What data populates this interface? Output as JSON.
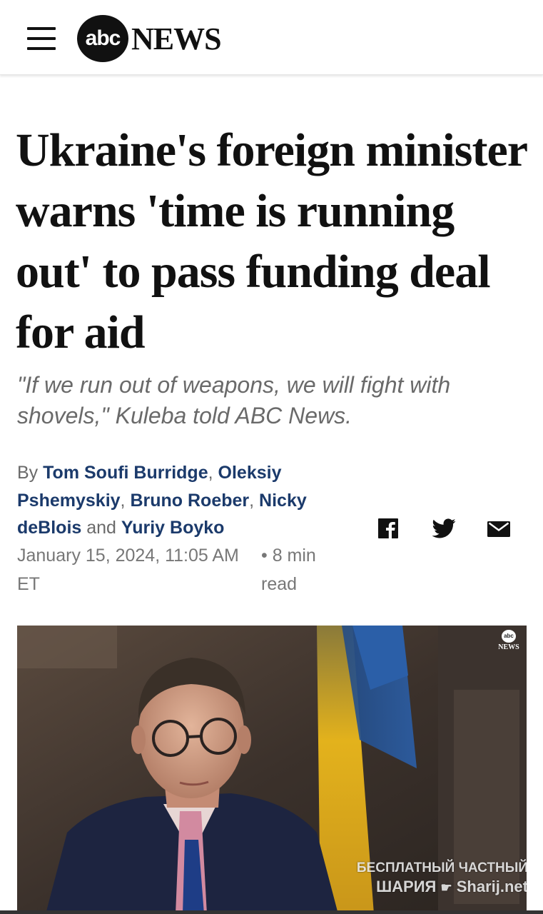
{
  "header": {
    "menu_icon": "hamburger-menu-icon",
    "logo_mark": "abc",
    "logo_word": "NEWS"
  },
  "article": {
    "headline": "Ukraine's foreign minister warns 'time is running out' to pass funding deal for aid",
    "dek": "\"If we run out of weapons, we will fight with shovels,\" Kuleba told ABC News.",
    "byline": {
      "prefix": "By",
      "authors": [
        "Tom Soufi Burridge",
        "Oleksiy Pshemyskiy",
        "Bruno Roeber",
        "Nicky deBlois",
        "Yuriy Boyko"
      ],
      "separator": ",",
      "conjunction": "and"
    },
    "date": "January 15, 2024, 11:05 AM ET",
    "read_time": "• 8 min read"
  },
  "share": {
    "facebook_icon": "facebook-icon",
    "twitter_icon": "twitter-icon",
    "email_icon": "email-icon"
  },
  "photo": {
    "bug_mark": "abc",
    "bug_word": "NEWS",
    "watermark_line1": "БЕСПЛАТНЫЙ ЧАСТНЫЙ",
    "watermark_line2a": "ШАРИЯ",
    "watermark_line2b": "Sharij.net"
  },
  "colors": {
    "author_link": "#1b3a6b",
    "meta_gray": "#777777",
    "flag_blue": "#2b5fa8",
    "flag_yellow": "#e3b21c"
  }
}
